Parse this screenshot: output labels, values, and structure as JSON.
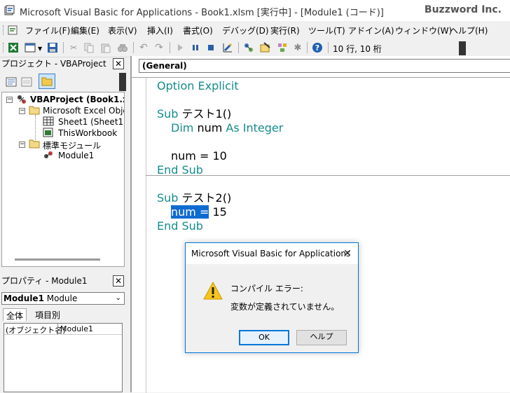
{
  "titlebar": {
    "title": "Microsoft Visual Basic for Applications - Book1.xlsm [実行中] - [Module1 (コード)]",
    "brand": "Buzzword Inc."
  },
  "menu": {
    "items": [
      "ファイル(F)",
      "編集(E)",
      "表示(V)",
      "挿入(I)",
      "書式(O)",
      "デバッグ(D)",
      "実行(R)",
      "ツール(T)",
      "アドイン(A)",
      "ウィンドウ(W)",
      "ヘルプ(H)"
    ]
  },
  "toolbar": {
    "position": "10 行, 10 桁"
  },
  "project_panel": {
    "title": "プロジェクト - VBAProject",
    "close": "✕",
    "tree": {
      "root": "VBAProject (Book1.xls",
      "excel_objects": "Microsoft Excel Object",
      "sheet1": "Sheet1 (Sheet1)",
      "workbook": "ThisWorkbook",
      "modules": "標準モジュール",
      "module1": "Module1"
    }
  },
  "properties_panel": {
    "title": "プロパティ - Module1",
    "close": "✕",
    "combo_bold": "Module1",
    "combo_rest": " Module",
    "tabs": [
      "全体",
      "項目別"
    ],
    "grid_label": "(オブジェクト名)",
    "grid_value": "Module1"
  },
  "code": {
    "combo": "(General)",
    "option_explicit": "Option Explicit",
    "sub1_kw": "Sub",
    "sub1_name": " テスト1()",
    "dim_kw": "Dim",
    "dim_var": " num ",
    "as_kw": "As Integer",
    "assign1": "num = 10",
    "end_sub1": "End Sub",
    "sub2_kw": "Sub",
    "sub2_name": " テスト2()",
    "assign2_selected": "num =",
    "assign2_rest": " 15",
    "end_sub2": "End Sub"
  },
  "dialog": {
    "title": "Microsoft Visual Basic for Applications",
    "close": "✕",
    "line1": "コンパイル エラー:",
    "line2": "変数が定義されていません。",
    "ok": "OK",
    "help": "ヘルプ"
  }
}
